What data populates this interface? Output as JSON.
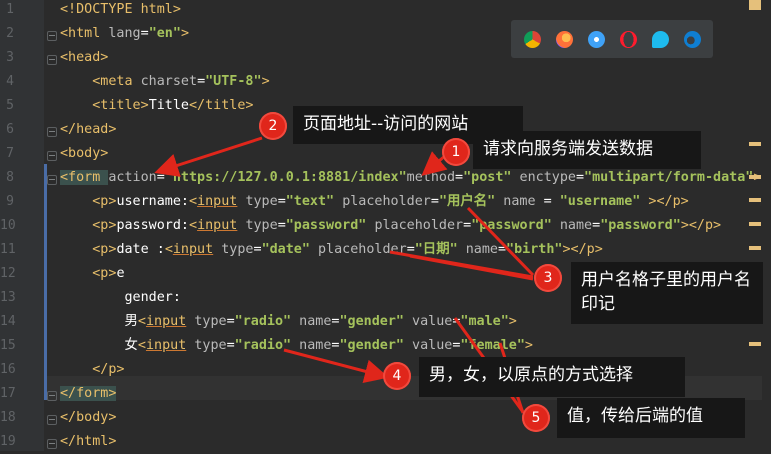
{
  "editor": {
    "lines": [
      {
        "n": "1",
        "parts": [
          [
            "doc",
            "<!DOCTYPE html>"
          ]
        ]
      },
      {
        "n": "2",
        "parts": [
          [
            "tag",
            "<html "
          ],
          [
            "attr",
            "lang"
          ],
          [
            "txt",
            "="
          ],
          [
            "str",
            "\"en\""
          ],
          [
            "tag",
            ">"
          ]
        ]
      },
      {
        "n": "3",
        "parts": [
          [
            "tag",
            "<head>"
          ]
        ]
      },
      {
        "n": "4",
        "parts": [
          [
            "txt",
            "    "
          ],
          [
            "tag",
            "<meta "
          ],
          [
            "attr",
            "charset"
          ],
          [
            "txt",
            "="
          ],
          [
            "str",
            "\"UTF-8\""
          ],
          [
            "tag",
            ">"
          ]
        ]
      },
      {
        "n": "5",
        "parts": [
          [
            "txt",
            "    "
          ],
          [
            "tag",
            "<title>"
          ],
          [
            "txt",
            "Title"
          ],
          [
            "tag",
            "</title>"
          ]
        ]
      },
      {
        "n": "6",
        "parts": [
          [
            "tag",
            "</head>"
          ]
        ]
      },
      {
        "n": "7",
        "parts": [
          [
            "tag",
            "<body>"
          ]
        ]
      },
      {
        "n": "8",
        "parts": [
          [
            "tag hl",
            "<form "
          ],
          [
            "attr",
            "action"
          ],
          [
            "txt",
            "="
          ],
          [
            "str",
            "\"https://127.0.0.1:8881/index\""
          ],
          [
            "attr",
            "method"
          ],
          [
            "txt",
            "="
          ],
          [
            "str",
            "\"post\""
          ],
          [
            "txt",
            " "
          ],
          [
            "attr",
            "enctype"
          ],
          [
            "txt",
            "="
          ],
          [
            "str",
            "\"multipart/form-data\""
          ],
          [
            "tag",
            ">"
          ]
        ]
      },
      {
        "n": "9",
        "parts": [
          [
            "txt",
            "    "
          ],
          [
            "tag",
            "<p>"
          ],
          [
            "txt",
            "username:"
          ],
          [
            "tag",
            "<"
          ],
          [
            "tag u",
            "input"
          ],
          [
            "txt",
            " "
          ],
          [
            "attr",
            "type"
          ],
          [
            "txt",
            "="
          ],
          [
            "str",
            "\"text\""
          ],
          [
            "txt",
            " "
          ],
          [
            "attr",
            "placeholder"
          ],
          [
            "txt",
            "="
          ],
          [
            "str",
            "\"用户名\""
          ],
          [
            "txt",
            " "
          ],
          [
            "attr",
            "name"
          ],
          [
            "txt",
            " = "
          ],
          [
            "str",
            "\"username\""
          ],
          [
            "txt",
            " "
          ],
          [
            "tag",
            ">"
          ],
          [
            "tag",
            "</p>"
          ]
        ]
      },
      {
        "n": "10",
        "parts": [
          [
            "txt",
            "    "
          ],
          [
            "tag",
            "<p>"
          ],
          [
            "txt",
            "password:"
          ],
          [
            "tag",
            "<"
          ],
          [
            "tag u",
            "input"
          ],
          [
            "txt",
            " "
          ],
          [
            "attr",
            "type"
          ],
          [
            "txt",
            "="
          ],
          [
            "str",
            "\"password\""
          ],
          [
            "txt",
            " "
          ],
          [
            "attr",
            "placeholder"
          ],
          [
            "txt",
            "="
          ],
          [
            "str",
            "\"password\""
          ],
          [
            "txt",
            " "
          ],
          [
            "attr",
            "name"
          ],
          [
            "txt",
            "="
          ],
          [
            "str",
            "\"password\""
          ],
          [
            "tag",
            ">"
          ],
          [
            "tag",
            "</p>"
          ]
        ]
      },
      {
        "n": "11",
        "parts": [
          [
            "txt",
            "    "
          ],
          [
            "tag",
            "<p>"
          ],
          [
            "txt",
            "date :"
          ],
          [
            "tag",
            "<"
          ],
          [
            "tag u",
            "input"
          ],
          [
            "txt",
            " "
          ],
          [
            "attr",
            "type"
          ],
          [
            "txt",
            "="
          ],
          [
            "str",
            "\"date\""
          ],
          [
            "txt",
            " "
          ],
          [
            "attr",
            "placeholder"
          ],
          [
            "txt",
            "="
          ],
          [
            "str",
            "\"日期\""
          ],
          [
            "txt",
            " "
          ],
          [
            "attr",
            "name"
          ],
          [
            "txt",
            "="
          ],
          [
            "str",
            "\"birth\""
          ],
          [
            "tag",
            ">"
          ],
          [
            "tag",
            "</p>"
          ]
        ]
      },
      {
        "n": "12",
        "parts": [
          [
            "txt",
            "    "
          ],
          [
            "tag",
            "<p>"
          ],
          [
            "txt",
            "e"
          ]
        ]
      },
      {
        "n": "13",
        "parts": [
          [
            "txt",
            "        gender:"
          ]
        ]
      },
      {
        "n": "14",
        "parts": [
          [
            "txt",
            "        男"
          ],
          [
            "tag",
            "<"
          ],
          [
            "tag u",
            "input"
          ],
          [
            "txt",
            " "
          ],
          [
            "attr",
            "type"
          ],
          [
            "txt",
            "="
          ],
          [
            "str",
            "\"radio\""
          ],
          [
            "txt",
            " "
          ],
          [
            "attr",
            "name"
          ],
          [
            "txt",
            "="
          ],
          [
            "str",
            "\"gender\""
          ],
          [
            "txt",
            " "
          ],
          [
            "attr",
            "value"
          ],
          [
            "txt",
            "="
          ],
          [
            "str",
            "\"male\""
          ],
          [
            "tag",
            ">"
          ]
        ]
      },
      {
        "n": "15",
        "parts": [
          [
            "txt",
            "        女"
          ],
          [
            "tag",
            "<"
          ],
          [
            "tag u",
            "input"
          ],
          [
            "txt",
            " "
          ],
          [
            "attr",
            "type"
          ],
          [
            "txt",
            "="
          ],
          [
            "str",
            "\"radio\""
          ],
          [
            "txt",
            " "
          ],
          [
            "attr",
            "name"
          ],
          [
            "txt",
            "="
          ],
          [
            "str",
            "\"gender\""
          ],
          [
            "txt",
            " "
          ],
          [
            "attr",
            "value"
          ],
          [
            "txt",
            "="
          ],
          [
            "str",
            "\"female\""
          ],
          [
            "tag",
            ">"
          ]
        ]
      },
      {
        "n": "16",
        "parts": [
          [
            "txt",
            "    "
          ],
          [
            "tag",
            "</p>"
          ]
        ]
      },
      {
        "n": "17",
        "parts": [
          [
            "tag hl",
            "</form>"
          ]
        ]
      },
      {
        "n": "18",
        "parts": [
          [
            "tag",
            "</body>"
          ]
        ]
      },
      {
        "n": "19",
        "parts": [
          [
            "tag",
            "</html>"
          ]
        ]
      }
    ]
  },
  "browser_icons": [
    {
      "name": "chrome-icon",
      "color": "#db4437"
    },
    {
      "name": "firefox-icon",
      "color": "#ff7139"
    },
    {
      "name": "safari-icon",
      "color": "#3fa2f7"
    },
    {
      "name": "opera-icon",
      "color": "#ff1b2d"
    },
    {
      "name": "ie-icon",
      "color": "#1ebbee"
    },
    {
      "name": "edge-icon",
      "color": "#0f7ed1"
    }
  ],
  "annotations": {
    "a1": {
      "num": "1",
      "text": "请求向服务端发送数据"
    },
    "a2": {
      "num": "2",
      "text": "页面地址--访问的网站"
    },
    "a3": {
      "num": "3",
      "text": "用户名格子里的用户名印记"
    },
    "a4": {
      "num": "4",
      "text": "男，女，以原点的方式选择"
    },
    "a5": {
      "num": "5",
      "text": "值，传给后端的值"
    }
  },
  "colors": {
    "accent_red": "#e0261b",
    "tag": "#e8bf6a",
    "string": "#a5c25c"
  }
}
